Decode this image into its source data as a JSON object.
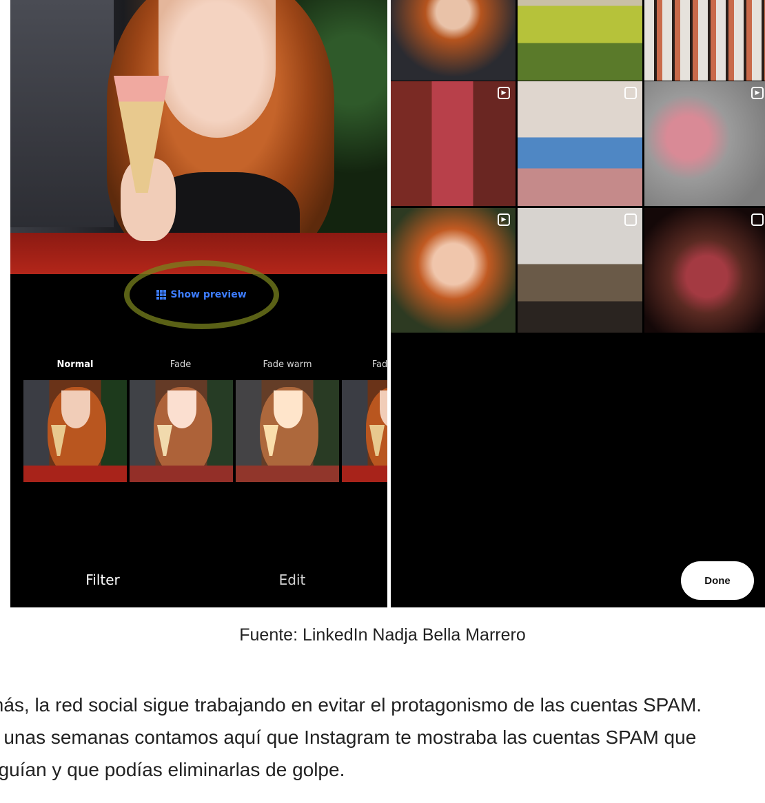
{
  "editor": {
    "show_preview_label": "Show preview",
    "filters": [
      {
        "label": "Normal",
        "active": true
      },
      {
        "label": "Fade",
        "active": false
      },
      {
        "label": "Fade warm",
        "active": false
      },
      {
        "label": "Fad",
        "active": false
      }
    ],
    "tabs": {
      "filter": "Filter",
      "edit": "Edit"
    }
  },
  "preview_grid": {
    "done_label": "Done",
    "tiles": [
      {
        "subject": "woman with ice cream",
        "badge": "none"
      },
      {
        "subject": "green drinks",
        "badge": "none"
      },
      {
        "subject": "moodboard wall",
        "badge": "none"
      },
      {
        "subject": "lip gloss tubes",
        "badge": "reel-icon"
      },
      {
        "subject": "woman sitting outdoors",
        "badge": "carousel-icon"
      },
      {
        "subject": "pink ballet shoes",
        "badge": "reel-icon"
      },
      {
        "subject": "woman with pink lip gloss",
        "badge": "reel-icon"
      },
      {
        "subject": "bedroom with macrame",
        "badge": "carousel-icon"
      },
      {
        "subject": "woman in sweater",
        "badge": "carousel-icon"
      }
    ]
  },
  "caption": "Fuente: LinkedIn Nadja Bella Marrero",
  "article": {
    "lines": [
      "más, la red social sigue trabajando en evitar el protagonismo de las cuentas SPAM.",
      "e unas semanas contamos aquí que Instagram te mostraba las cuentas SPAM que",
      "eguían y que podías eliminarlas de golpe."
    ]
  },
  "colors": {
    "accent_blue": "#3d7dff",
    "highlight_ring": "#78821e",
    "background": "#000000"
  }
}
